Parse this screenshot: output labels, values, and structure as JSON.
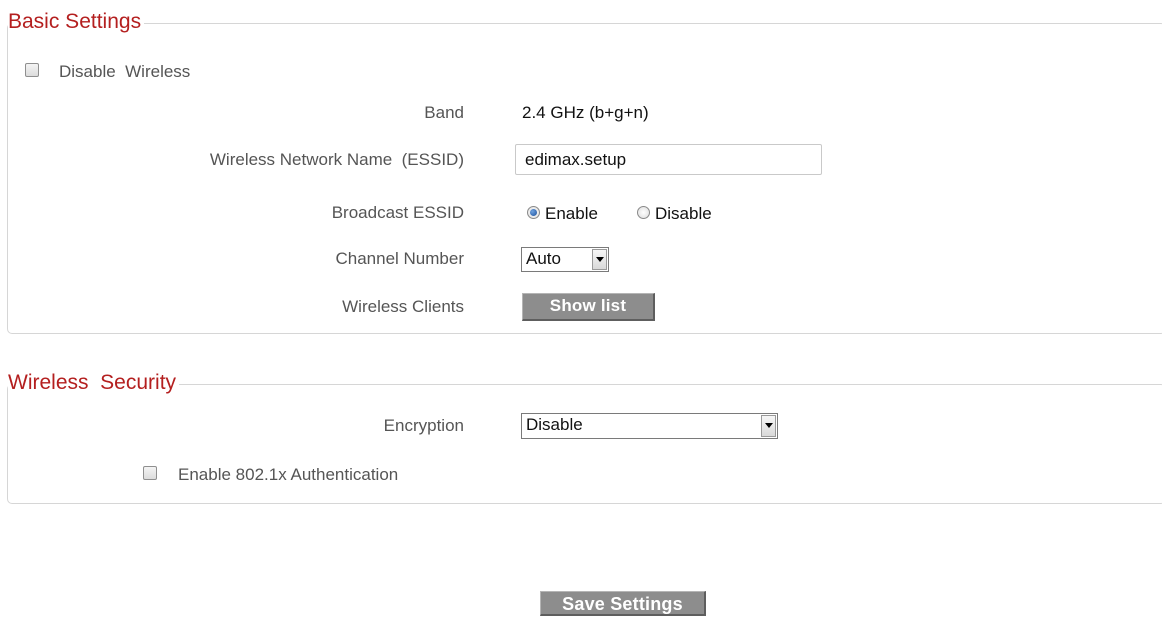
{
  "basic": {
    "legend": "Basic Settings",
    "disable_wireless_label": "Disable  Wireless",
    "disable_wireless_checked": false,
    "band_label": "Band",
    "band_value": "2.4 GHz (b+g+n)",
    "essid_label": "Wireless Network Name  (ESSID)",
    "essid_value": "edimax.setup",
    "broadcast_label": "Broadcast ESSID",
    "broadcast_enable": "Enable",
    "broadcast_disable": "Disable",
    "broadcast_selected": "Enable",
    "channel_label": "Channel Number",
    "channel_value": "Auto",
    "clients_label": "Wireless Clients",
    "show_list_button": "Show list"
  },
  "security": {
    "legend": "Wireless  Security",
    "encryption_label": "Encryption",
    "encryption_value": "Disable",
    "auth_label": "Enable 802.1x Authentication",
    "auth_checked": false
  },
  "footer": {
    "save_button": "Save Settings"
  },
  "colors": {
    "legend": "#b41f1f",
    "button_bg": "#8d8d8d",
    "border": "#d6d6d6"
  },
  "icons": {
    "select_arrow": "chevron-down-icon",
    "radio_selected": "radio-on-icon",
    "radio_unselected": "radio-off-icon"
  }
}
